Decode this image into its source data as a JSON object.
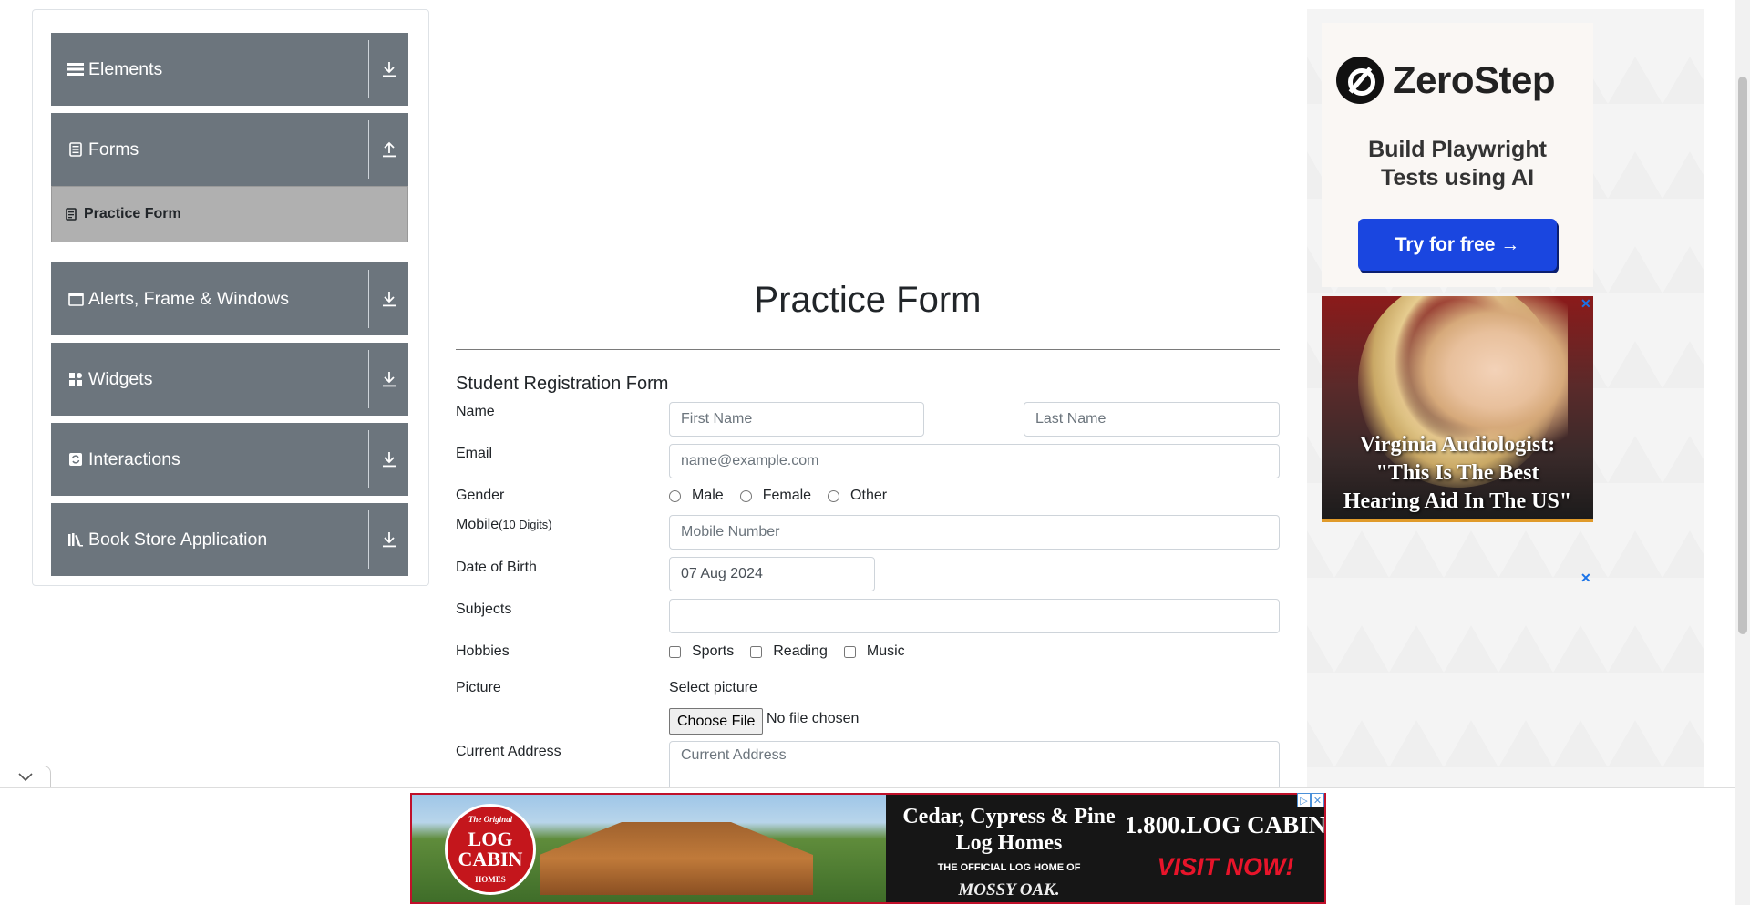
{
  "sidebar": {
    "groups": [
      {
        "label": "Elements",
        "icon": "list-icon",
        "toggle": "download-icon"
      },
      {
        "label": "Forms",
        "icon": "document-icon",
        "toggle": "upload-icon"
      },
      {
        "label": "Alerts, Frame & Windows",
        "icon": "window-icon",
        "toggle": "download-icon"
      },
      {
        "label": "Widgets",
        "icon": "widgets-icon",
        "toggle": "download-icon"
      },
      {
        "label": "Interactions",
        "icon": "refresh-icon",
        "toggle": "download-icon"
      },
      {
        "label": "Book Store Application",
        "icon": "books-icon",
        "toggle": "download-icon"
      }
    ],
    "active_item": "Practice Form"
  },
  "main": {
    "title": "Practice Form",
    "form_title": "Student Registration Form",
    "labels": {
      "name": "Name",
      "email": "Email",
      "gender": "Gender",
      "mobile": "Mobile",
      "mobile_hint": "(10 Digits)",
      "dob": "Date of Birth",
      "subjects": "Subjects",
      "hobbies": "Hobbies",
      "picture": "Picture",
      "address": "Current Address"
    },
    "placeholders": {
      "first_name": "First Name",
      "last_name": "Last Name",
      "email": "name@example.com",
      "mobile": "Mobile Number",
      "address": "Current Address"
    },
    "values": {
      "dob": "07 Aug 2024",
      "subjects": ""
    },
    "gender_options": [
      "Male",
      "Female",
      "Other"
    ],
    "hobby_options": [
      "Sports",
      "Reading",
      "Music"
    ],
    "picture": {
      "select_label": "Select picture",
      "button": "Choose File",
      "status": "No file chosen"
    }
  },
  "ads": {
    "zerostep": {
      "brand": "ZeroStep",
      "tagline_1": "Build Playwright",
      "tagline_2": "Tests using AI",
      "button": "Try for free →"
    },
    "audiologist": {
      "line_1": "Virginia Audiologist:",
      "line_2": "\"This Is The Best",
      "line_3": "Hearing Aid In The US\""
    },
    "log_cabin": {
      "badge_1": "The Original",
      "badge_2": "LOG",
      "badge_3": "CABIN",
      "badge_4": "HOMES",
      "headline_1": "Cedar, Cypress & Pine",
      "headline_2": "Log Homes",
      "sub": "THE OFFICIAL LOG HOME OF",
      "partner": "MOSSY OAK.",
      "phone": "1.800.LOG CABIN",
      "cta": "VISIT NOW!"
    },
    "close_glyph": "✕",
    "adchoices_glyph": "▷"
  },
  "colors": {
    "sidebar_header": "#6c757d",
    "sidebar_active": "#b0b0b0",
    "accent_button": "#1a46e0",
    "ad_border": "#c0102a"
  }
}
